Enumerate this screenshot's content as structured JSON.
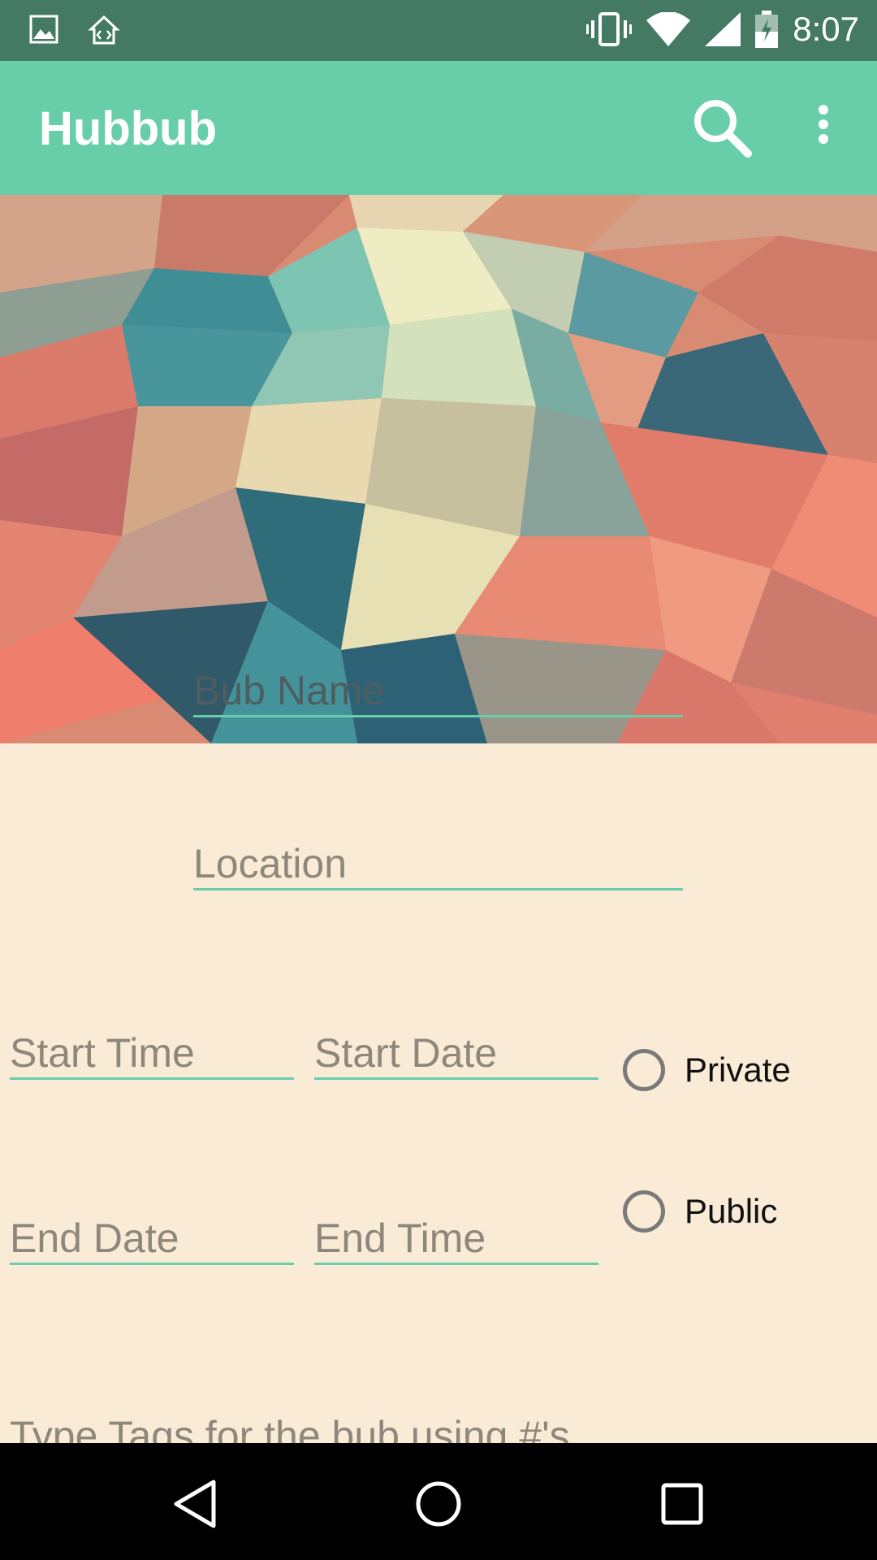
{
  "status_bar": {
    "time": "8:07",
    "icons": [
      "image-icon",
      "home-code-icon",
      "vibrate-icon",
      "wifi-icon",
      "signal-icon",
      "battery-charging-icon"
    ]
  },
  "app_bar": {
    "title": "Hubbub",
    "actions": [
      "search-icon",
      "more-vert-icon"
    ]
  },
  "form": {
    "bub_name_placeholder": "Bub Name",
    "location_placeholder": "Location",
    "start_time_placeholder": "Start Time",
    "start_date_placeholder": "Start Date",
    "end_date_placeholder": "End Date",
    "end_time_placeholder": "End Time",
    "visibility_options": [
      "Private",
      "Public"
    ],
    "tags_placeholder": "Type Tags for the bub using #'s"
  },
  "nav_bar": {
    "buttons": [
      "back-icon",
      "home-icon",
      "recents-icon"
    ]
  },
  "colors": {
    "status_bar": "#447a63",
    "app_bar": "#68cea9",
    "accent": "#68cea9",
    "background": "#faebd7",
    "nav_bar": "#000000"
  }
}
